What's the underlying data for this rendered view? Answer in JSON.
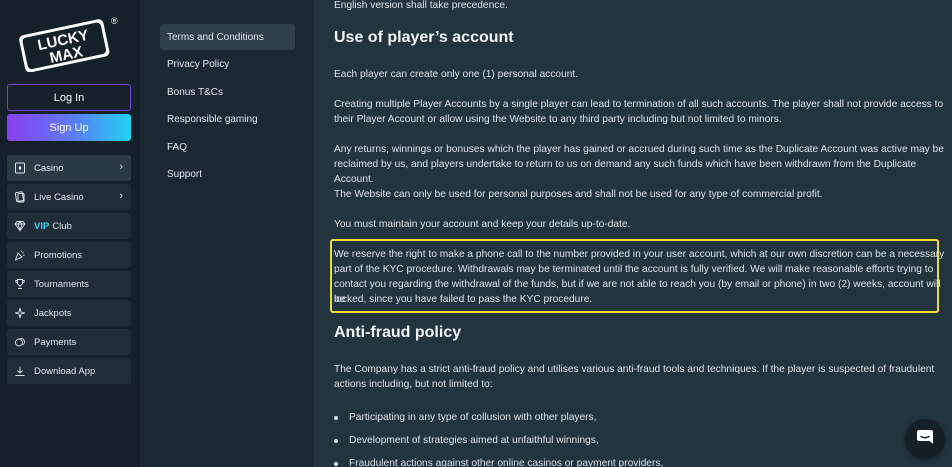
{
  "brand": {
    "logo_text_top": "LUCKY",
    "logo_text_bottom": "MAX",
    "registered": "®"
  },
  "auth": {
    "login_label": "Log In",
    "signup_label": "Sign Up"
  },
  "nav": [
    {
      "label": "Casino",
      "icon": "cards-icon"
    },
    {
      "label": "Live Casino",
      "icon": "live-casino-icon"
    },
    {
      "prefix": "VIP",
      "label": "Club",
      "icon": "diamond-icon"
    },
    {
      "label": "Promotions",
      "icon": "party-icon"
    },
    {
      "label": "Tournaments",
      "icon": "trophy-icon"
    },
    {
      "label": "Jackpots",
      "icon": "sparkle-icon"
    },
    {
      "label": "Payments",
      "icon": "coins-icon"
    },
    {
      "label": "Download App",
      "icon": "download-icon"
    }
  ],
  "menu": [
    {
      "label": "Terms and Conditions"
    },
    {
      "label": "Privacy Policy"
    },
    {
      "label": "Bonus T&Cs"
    },
    {
      "label": "Responsible gaming"
    },
    {
      "label": "FAQ"
    },
    {
      "label": "Support"
    }
  ],
  "content": {
    "top_fragment": "English version shall take precedence.",
    "heading_account": "Use of player’s account",
    "p1": "Each player can create only one (1) personal account.",
    "p2_line1": "Creating multiple Player Accounts by a single player can lead to termination of all such accounts. The player shall not provide access to",
    "p2_line2": "their Player Account or allow using the Website to any third party including but not limited to minors.",
    "p3_line1": "Any returns, winnings or bonuses which the player has gained or accrued during such time as the Duplicate Account was active may be",
    "p3_line2": "reclaimed by us, and players undertake to return to us on demand any such funds which have been withdrawn from the Duplicate Account.",
    "p4": "The Website can only be used for personal purposes and shall not be used for any type of commercial profit.",
    "p5": "You must maintain your account and keep your details up-to-date.",
    "p6_line1": "We reserve the right to make a phone call to the number provided in your user account, which at our own discretion can be a necessary",
    "p6_line2": "part of the KYC procedure. Withdrawals may be terminated until the account is fully verified. We will make reasonable efforts trying to",
    "p6_line3": "contact you regarding the withdrawal of the funds, but if we are not able to reach you (by email or phone) in two (2) weeks, account will be",
    "p6_line4": "locked, since you have failed to pass the KYC procedure.",
    "heading_fraud": "Anti-fraud policy",
    "p7_line1": "The Company has a strict anti-fraud policy and utilises various anti-fraud tools and techniques. If the player is suspected of fraudulent",
    "p7_line2": "actions including, but not limited to:",
    "bullets": [
      "Participating in any type of collusion with other players,",
      "Development of strategies aimed at unfaithful winnings,",
      "Fraudulent actions against other online casinos or payment providers,"
    ]
  },
  "colors": {
    "highlight": "#f1da2e",
    "accent_cyan": "#35d7f0",
    "accent_purple": "#7b3fe4"
  },
  "chat": {
    "icon": "chat-icon"
  }
}
